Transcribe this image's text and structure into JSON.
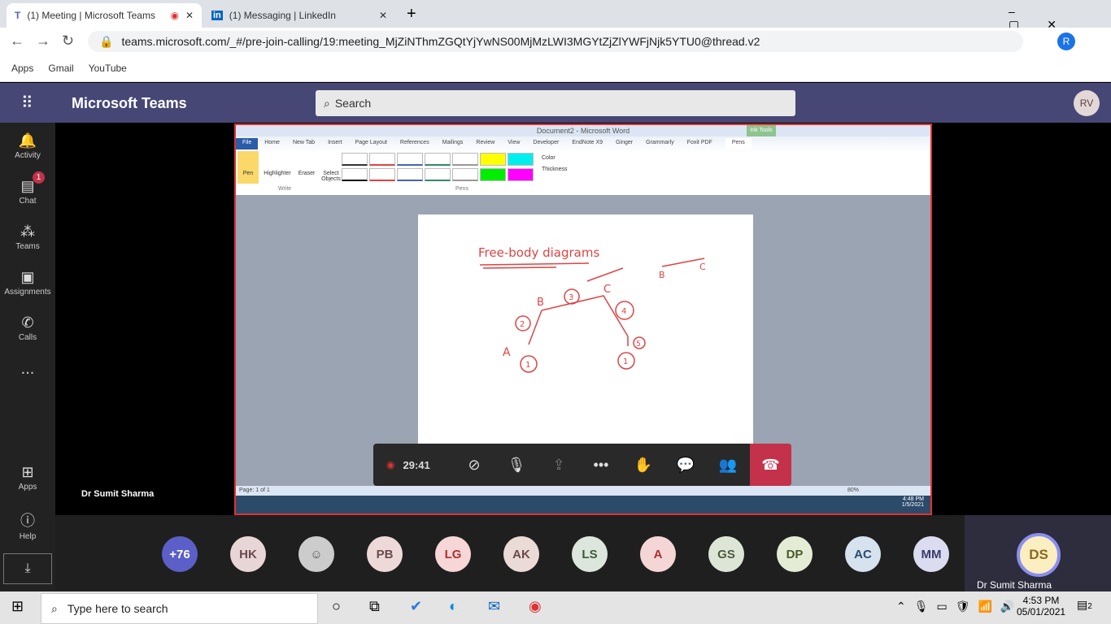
{
  "browser": {
    "tabs": [
      {
        "title": "(1) Meeting | Microsoft Teams",
        "recording": true
      },
      {
        "title": "(1) Messaging | LinkedIn"
      }
    ],
    "url": "teams.microsoft.com/_#/pre-join-calling/19:meeting_MjZiNThmZGQtYjYwNS00MjMzLWI3MGYtZjZlYWFjNjk5YTU0@thread.v2",
    "profile": "R",
    "bookmarks": [
      "Apps",
      "Gmail",
      "YouTube"
    ]
  },
  "teams": {
    "title": "Microsoft Teams",
    "search_placeholder": "Search",
    "user_initials": "RV",
    "accent": "#464775",
    "rail": [
      {
        "label": "Activity",
        "icon": "bell-icon"
      },
      {
        "label": "Chat",
        "icon": "chat-icon",
        "badge": "1"
      },
      {
        "label": "Teams",
        "icon": "teams-icon"
      },
      {
        "label": "Assignments",
        "icon": "assignments-icon"
      },
      {
        "label": "Calls",
        "icon": "phone-icon"
      },
      {
        "label": "...",
        "icon": "more-icon"
      },
      {
        "label": "Apps",
        "icon": "apps-icon"
      },
      {
        "label": "Help",
        "icon": "help-icon"
      }
    ],
    "presenter_label": "Dr Sumit Sharma",
    "call": {
      "timer": "29:41"
    },
    "participants": [
      {
        "i": "+76",
        "c": "#5b5fc7",
        "f": "#fff"
      },
      {
        "i": "HK",
        "c": "#e8d6d6",
        "f": "#6b4b4b"
      },
      {
        "i": "",
        "c": "#ccc",
        "f": "#555"
      },
      {
        "i": "PB",
        "c": "#eed9d9",
        "f": "#6b4b4b"
      },
      {
        "i": "LG",
        "c": "#f6d6d6",
        "f": "#a33"
      },
      {
        "i": "AK",
        "c": "#eadbd6",
        "f": "#6b4b4b"
      },
      {
        "i": "LS",
        "c": "#dde6dd",
        "f": "#3b5b3b"
      },
      {
        "i": "A",
        "c": "#f4d6d6",
        "f": "#a33"
      },
      {
        "i": "GS",
        "c": "#dde6d6",
        "f": "#4b5b3b"
      },
      {
        "i": "DP",
        "c": "#e4ecd6",
        "f": "#4b5b2b"
      },
      {
        "i": "AC",
        "c": "#d6e2ee",
        "f": "#2b4b6b"
      },
      {
        "i": "MM",
        "c": "#dcdcf0",
        "f": "#3b3b6b"
      }
    ],
    "presenter_tile": {
      "initials": "DS",
      "name": "Dr Sumit Sharma"
    }
  },
  "shared_screen": {
    "window_title": "Document2 - Microsoft Word",
    "contextual_tab": "Ink Tools",
    "tabs": [
      "File",
      "Home",
      "New Tab",
      "Insert",
      "Page Layout",
      "References",
      "Mailings",
      "Review",
      "View",
      "Developer",
      "EndNote X9",
      "Ginger",
      "Grammarly",
      "Foxit PDF",
      "Pens"
    ],
    "write_tools": [
      "Pen",
      "Highlighter",
      "Eraser",
      "Select Objects"
    ],
    "groups": [
      "Write",
      "Pens"
    ],
    "pen_options": [
      "Color",
      "Thickness"
    ],
    "drawing": {
      "heading": "Free-body diagrams",
      "labels": [
        "A",
        "B",
        "C",
        "B",
        "C",
        "2",
        "3",
        "4",
        "1",
        "1",
        "5"
      ]
    },
    "status": "Page: 1 of 1",
    "zoom": "80%",
    "clock": "4:48 PM",
    "date": "1/5/2021"
  },
  "taskbar": {
    "search_placeholder": "Type here to search",
    "time": "4:53 PM",
    "date": "05/01/2021",
    "notifications": "2"
  }
}
